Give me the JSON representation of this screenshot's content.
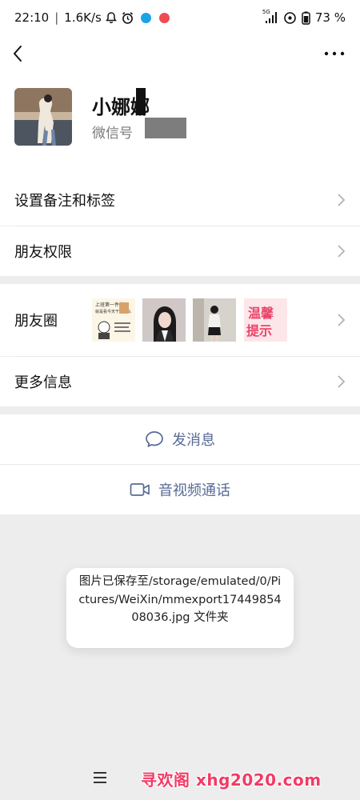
{
  "status_bar": {
    "time": "22:10",
    "speed": "1.6K/s",
    "separator": "|",
    "network": "5G",
    "battery": "73",
    "battery_unit": "%"
  },
  "profile": {
    "name": "小娜娜",
    "wechat_id_label": "微信号"
  },
  "menu": {
    "remark_tags": "设置备注和标签",
    "friend_permissions": "朋友权限",
    "moments": "朋友圈",
    "more_info": "更多信息"
  },
  "moments_thumbs": [
    {
      "caption_line1": "上班第一件事",
      "caption_line2": "就是看今天干点什么"
    },
    {
      "caption_line1": ""
    },
    {
      "caption_line1": ""
    },
    {
      "caption_line1": "温馨",
      "caption_line2": "提示"
    }
  ],
  "actions": {
    "send_message": "发消息",
    "video_call": "音视频通话"
  },
  "toast": {
    "message": "图片已保存至/storage/emulated/0/Pictures/WeiXin/mmexport1744985408036.jpg 文件夹"
  },
  "watermark": {
    "text": "寻欢阁 xhg2020.com"
  },
  "colors": {
    "link_blue": "#576b95",
    "page_bg": "#ededed",
    "watermark_pink": "#f23b66"
  }
}
